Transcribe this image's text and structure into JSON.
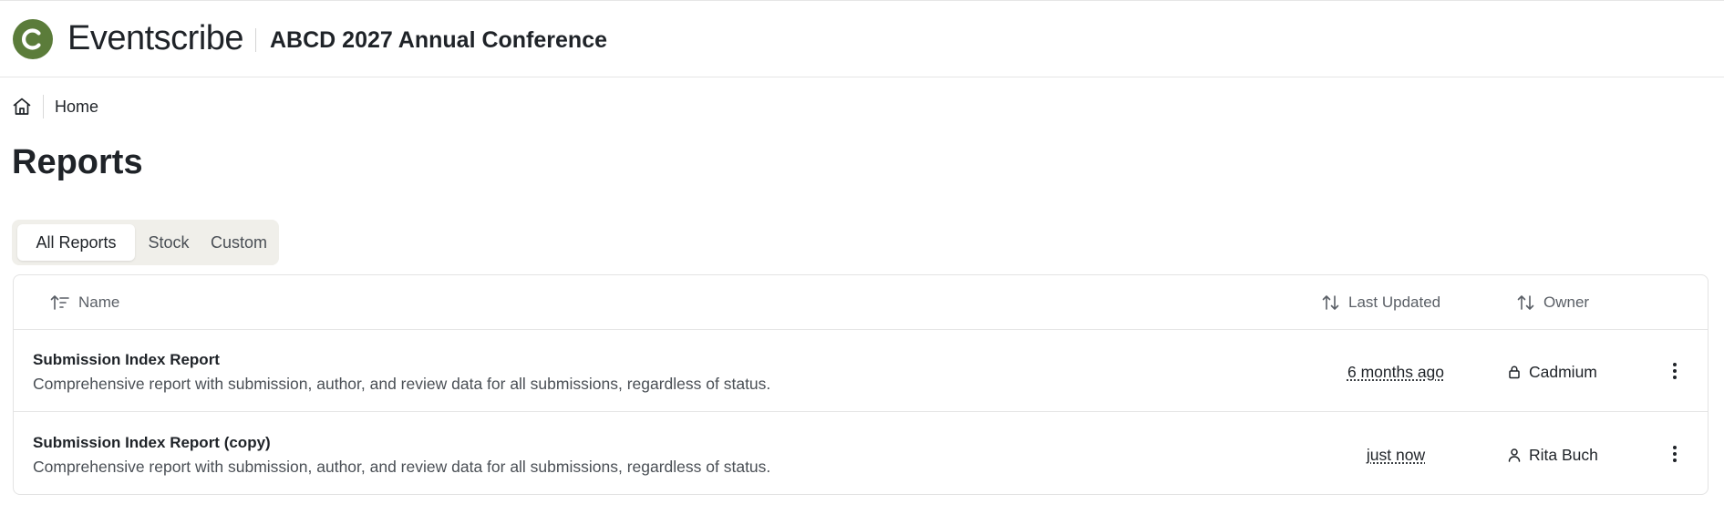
{
  "header": {
    "logo_icon": "eventscribe-logo-icon",
    "brand": "Eventscribe",
    "conference_title": "ABCD 2027 Annual Conference",
    "brand_color": "#5b7c3a"
  },
  "breadcrumb": {
    "home_icon": "home-icon",
    "label": "Home"
  },
  "page": {
    "title": "Reports"
  },
  "tabs": [
    {
      "label": "All Reports",
      "active": true
    },
    {
      "label": "Stock",
      "active": false
    },
    {
      "label": "Custom",
      "active": false
    }
  ],
  "table": {
    "columns": {
      "name": {
        "label": "Name",
        "icon": "sort-ascending-icon"
      },
      "last_updated": {
        "label": "Last Updated",
        "icon": "sort-icon"
      },
      "owner": {
        "label": "Owner",
        "icon": "sort-icon"
      }
    },
    "rows": [
      {
        "name": "Submission Index Report",
        "description": "Comprehensive report with submission, author, and review data for all submissions, regardless of status.",
        "last_updated": "6 months ago",
        "owner": "Cadmium",
        "owner_icon": "lock-icon",
        "menu_icon": "more-vertical-icon"
      },
      {
        "name": "Submission Index Report (copy)",
        "description": "Comprehensive report with submission, author, and review data for all submissions, regardless of status.",
        "last_updated": "just now",
        "owner": "Rita Buch",
        "owner_icon": "user-icon",
        "menu_icon": "more-vertical-icon"
      }
    ]
  }
}
